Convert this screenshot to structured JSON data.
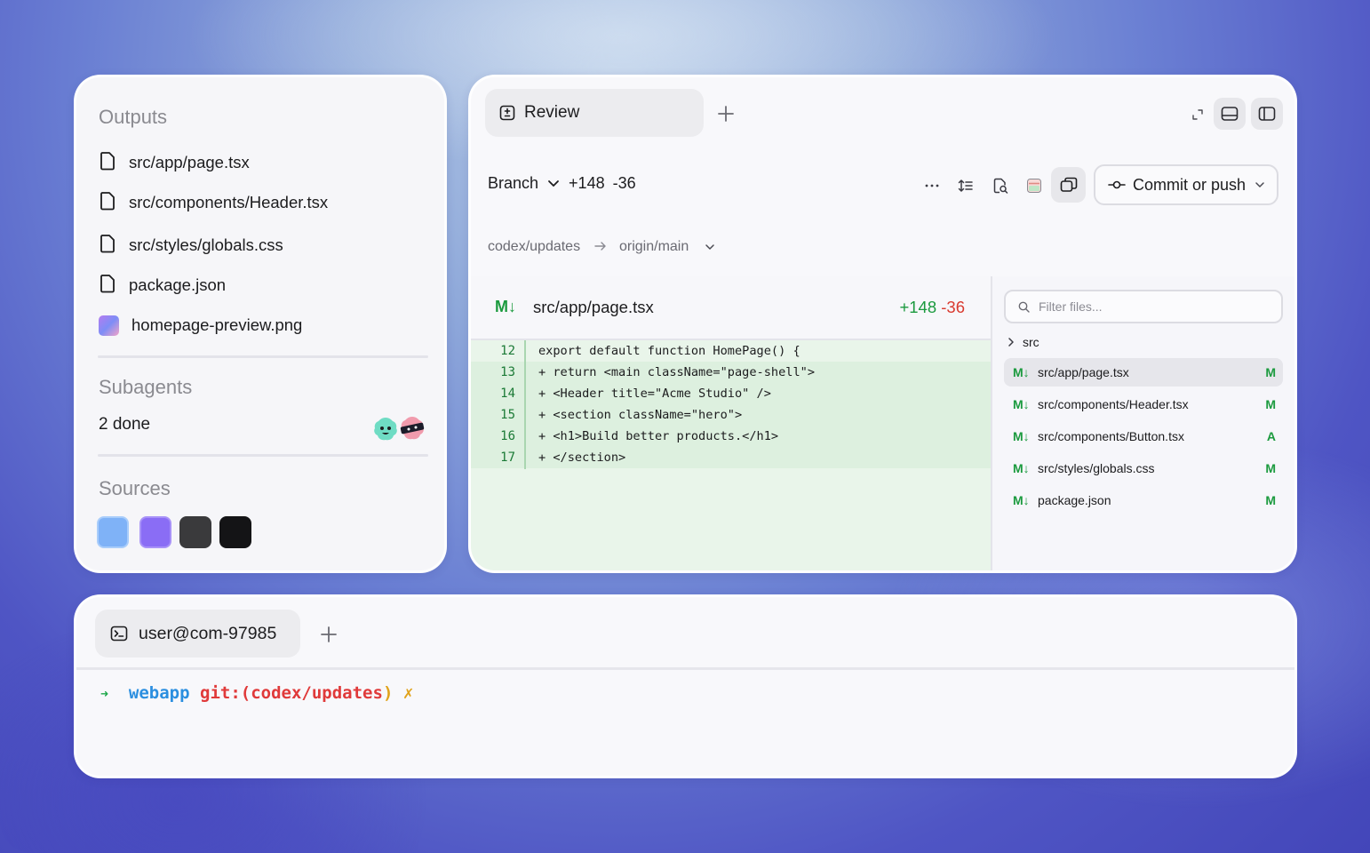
{
  "outputs": {
    "title": "Outputs",
    "files": [
      {
        "name": "src/app/page.tsx",
        "icon": "file-icon"
      },
      {
        "name": "src/components/Header.tsx",
        "icon": "file-icon"
      },
      {
        "name": "src/styles/globals.css",
        "icon": "file-icon"
      },
      {
        "name": "package.json",
        "icon": "file-icon"
      },
      {
        "name": "homepage-preview.png",
        "icon": "image-thumbnail"
      }
    ]
  },
  "subagents": {
    "title": "Subagents",
    "status": "2 done"
  },
  "sources": {
    "title": "Sources",
    "colors": [
      "#7fb2f7",
      "#8a6df5",
      "#3a3a3c",
      "#141416"
    ]
  },
  "review": {
    "tab_label": "Review",
    "branch_label": "Branch",
    "additions": "+148",
    "deletions": "-36",
    "commit_label": "Commit or push",
    "source_branch": "codex/updates",
    "target_branch": "origin/main",
    "diff": {
      "badge": "M↓",
      "file": "src/app/page.tsx",
      "additions": "+148",
      "deletions": "-36",
      "lines": [
        {
          "num": "12",
          "code": "export default function HomePage() {",
          "added": false
        },
        {
          "num": "13",
          "code": "+ return <main className=\"page-shell\">",
          "added": true
        },
        {
          "num": "14",
          "code": "+ <Header title=\"Acme Studio\" />",
          "added": true
        },
        {
          "num": "15",
          "code": "+ <section className=\"hero\">",
          "added": true
        },
        {
          "num": "16",
          "code": "+ <h1>Build better products.</h1>",
          "added": true
        },
        {
          "num": "17",
          "code": "+ </section>",
          "added": true
        }
      ]
    },
    "files_panel": {
      "filter_placeholder": "Filter files...",
      "folder": "src",
      "files": [
        {
          "badge": "M↓",
          "path": "src/app/page.tsx",
          "status": "M",
          "selected": true
        },
        {
          "badge": "M↓",
          "path": "src/components/Header.tsx",
          "status": "M",
          "selected": false
        },
        {
          "badge": "M↓",
          "path": "src/components/Button.tsx",
          "status": "A",
          "selected": false
        },
        {
          "badge": "M↓",
          "path": "src/styles/globals.css",
          "status": "M",
          "selected": false
        },
        {
          "badge": "M↓",
          "path": "package.json",
          "status": "M",
          "selected": false
        }
      ]
    }
  },
  "terminal": {
    "tab_label": "user@com-97985",
    "prompt": {
      "arrow": "➜",
      "dir": "webapp",
      "git_prefix": "git:(",
      "branch": "codex/updates",
      "git_suffix": ")",
      "dirty": "✗"
    }
  },
  "colors": {
    "added_green": "#1b9a3e",
    "deleted_red": "#d93a2f",
    "prompt_arrow": "#1ea84a",
    "prompt_dir": "#2b8fe0",
    "prompt_git": "#e03a3a",
    "prompt_dirty": "#e0a21a"
  }
}
